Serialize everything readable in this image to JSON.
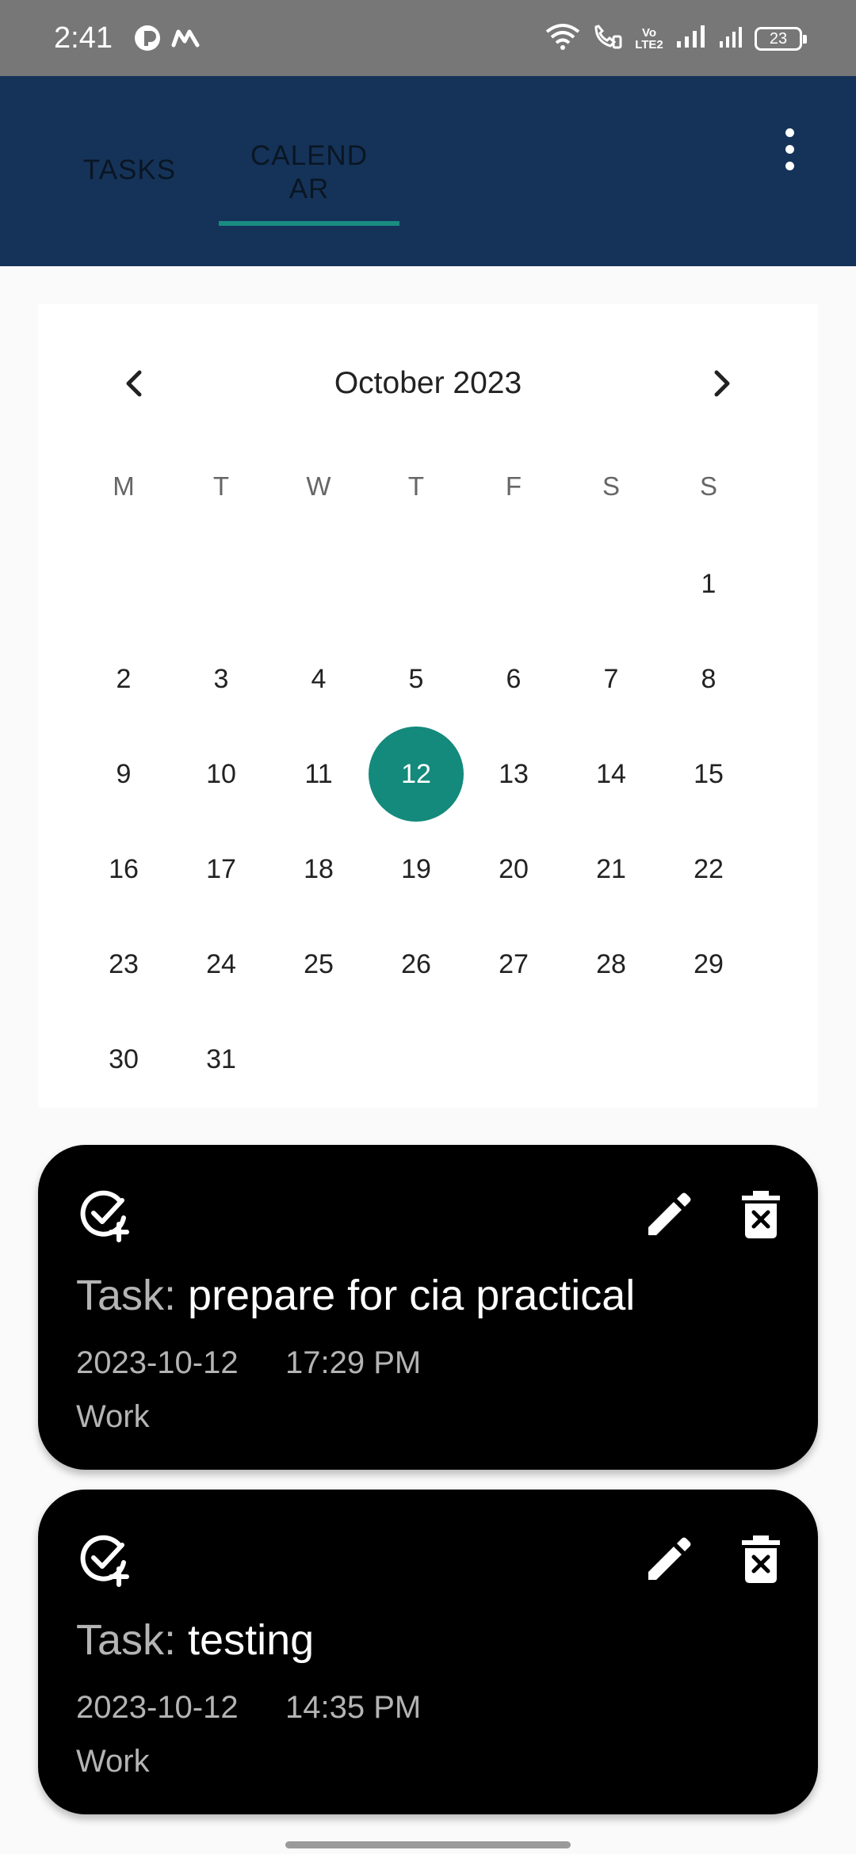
{
  "status_bar": {
    "time": "2:41",
    "volte_label": "Vo\nLTE2",
    "battery": "23",
    "icons": [
      "app-icon",
      "m-icon",
      "wifi-icon",
      "wifi-call-icon",
      "volte-icon",
      "signal-icon",
      "signal-icon-2",
      "battery-icon"
    ]
  },
  "app_bar": {
    "tabs": [
      {
        "label": "TASKS",
        "selected": false
      },
      {
        "label": "CALEND\nAR",
        "selected": true
      }
    ],
    "menu_icon": "more-vert-icon",
    "colors": {
      "background": "#153358",
      "indicator": "#1a8c82"
    }
  },
  "calendar": {
    "month_label": "October 2023",
    "prev_icon": "chevron-left-icon",
    "next_icon": "chevron-right-icon",
    "weekdays": [
      "M",
      "T",
      "W",
      "T",
      "F",
      "S",
      "S"
    ],
    "first_weekday_index": 6,
    "days_in_month": 31,
    "selected_day": "12",
    "selected_color": "#138a7c"
  },
  "tasks": [
    {
      "prefix": "Task: ",
      "name": "prepare for cia practical",
      "date": "2023-10-12",
      "time": "17:29 PM",
      "category": "Work"
    },
    {
      "prefix": "Task: ",
      "name": "testing",
      "date": "2023-10-12",
      "time": "14:35 PM",
      "category": "Work"
    }
  ]
}
